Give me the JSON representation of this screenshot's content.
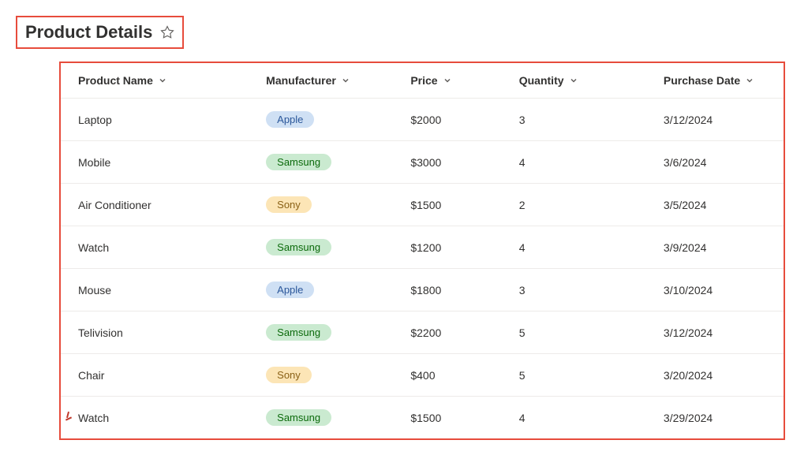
{
  "header": {
    "title": "Product Details"
  },
  "table": {
    "columns": [
      {
        "label": "Product Name"
      },
      {
        "label": "Manufacturer"
      },
      {
        "label": "Price"
      },
      {
        "label": "Quantity"
      },
      {
        "label": "Purchase Date"
      }
    ],
    "rows": [
      {
        "product": "Laptop",
        "manufacturer": "Apple",
        "mfr_style": "apple",
        "price": "$2000",
        "quantity": "3",
        "date": "3/12/2024",
        "marked": false
      },
      {
        "product": "Mobile",
        "manufacturer": "Samsung",
        "mfr_style": "samsung",
        "price": "$3000",
        "quantity": "4",
        "date": "3/6/2024",
        "marked": false
      },
      {
        "product": "Air Conditioner",
        "manufacturer": "Sony",
        "mfr_style": "sony",
        "price": "$1500",
        "quantity": "2",
        "date": "3/5/2024",
        "marked": false
      },
      {
        "product": "Watch",
        "manufacturer": "Samsung",
        "mfr_style": "samsung",
        "price": "$1200",
        "quantity": "4",
        "date": "3/9/2024",
        "marked": false
      },
      {
        "product": "Mouse",
        "manufacturer": "Apple",
        "mfr_style": "apple",
        "price": "$1800",
        "quantity": "3",
        "date": "3/10/2024",
        "marked": false
      },
      {
        "product": "Telivision",
        "manufacturer": "Samsung",
        "mfr_style": "samsung",
        "price": "$2200",
        "quantity": "5",
        "date": "3/12/2024",
        "marked": false
      },
      {
        "product": "Chair",
        "manufacturer": "Sony",
        "mfr_style": "sony",
        "price": "$400",
        "quantity": "5",
        "date": "3/20/2024",
        "marked": false
      },
      {
        "product": "Watch",
        "manufacturer": "Samsung",
        "mfr_style": "samsung",
        "price": "$1500",
        "quantity": "4",
        "date": "3/29/2024",
        "marked": true
      }
    ]
  }
}
